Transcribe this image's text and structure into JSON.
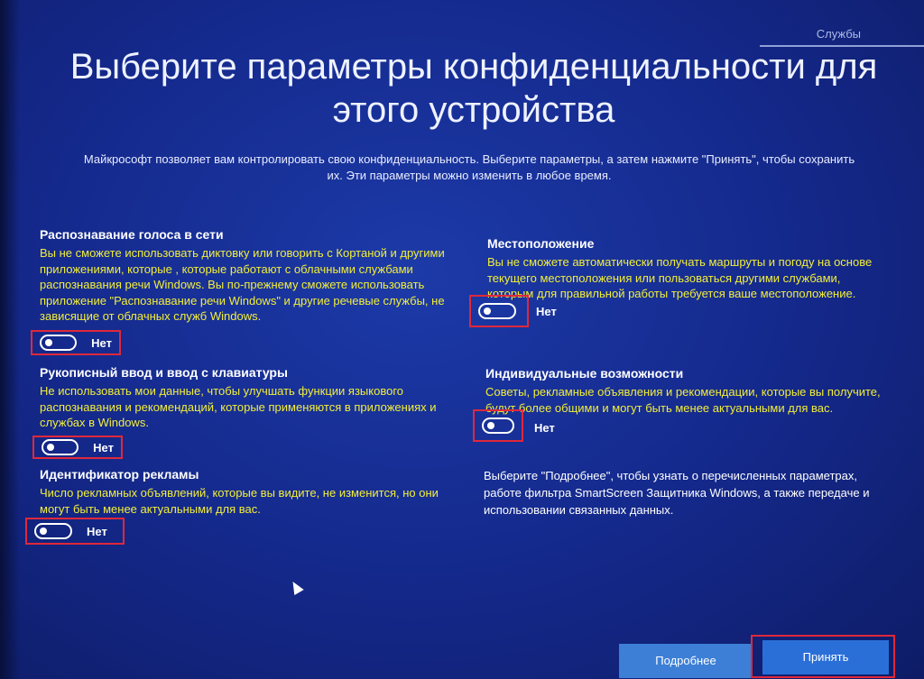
{
  "header": {
    "tab_label": "Службы",
    "title": "Выберите параметры конфиденциальности для этого устройства",
    "subtitle": "Майкрософт позволяет вам контролировать свою конфиденциальность. Выберите параметры, а затем нажмите \"Принять\", чтобы сохранить их. Эти параметры можно изменить в любое время."
  },
  "left": [
    {
      "heading": "Распознавание голоса в сети",
      "text": "Вы не сможете использовать диктовку или говорить с Кортаной и другими приложениями, которые , которые работают с облачными службами распознавания речи Windows. Вы по-прежнему сможете использовать приложение \"Распознавание речи Windows\" и другие речевые службы, не зависящие от облачных служб Windows.",
      "toggle_label": "Нет",
      "toggle_on": false
    },
    {
      "heading": "Рукописный ввод и ввод с клавиатуры",
      "text": "Не использовать мои данные, чтобы улучшать функции языкового распознавания и рекомендаций, которые применяются в приложениях и службах в Windows.",
      "toggle_label": "Нет",
      "toggle_on": false
    },
    {
      "heading": "Идентификатор рекламы",
      "text": "Число рекламных объявлений, которые вы видите, не изменится, но они могут быть менее актуальными для вас.",
      "toggle_label": "Нет",
      "toggle_on": false
    }
  ],
  "right": [
    {
      "heading": "Местоположение",
      "text": "Вы не сможете автоматически получать маршруты и погоду на основе текущего местоположения или пользоваться другими службами, которым для правильной работы требуется ваше местоположение.",
      "toggle_label": "Нет",
      "toggle_on": false
    },
    {
      "heading": "Индивидуальные возможности",
      "text": "Советы, рекламные объявления и рекомендации, которые вы получите, будут более общими и могут быть менее актуальными для вас.",
      "toggle_label": "Нет",
      "toggle_on": false
    }
  ],
  "info_text": "Выберите \"Подробнее\", чтобы узнать о перечисленных параметрах, работе фильтра SmartScreen Защитника Windows, а также передаче и использовании связанных данных.",
  "buttons": {
    "more_label": "Подробнее",
    "accept_label": "Принять"
  },
  "colors": {
    "background": "#1a35a0",
    "highlight_text": "#f2ee3a",
    "annotation_border": "#e0283a",
    "accept_button": "#2a6fd8"
  }
}
